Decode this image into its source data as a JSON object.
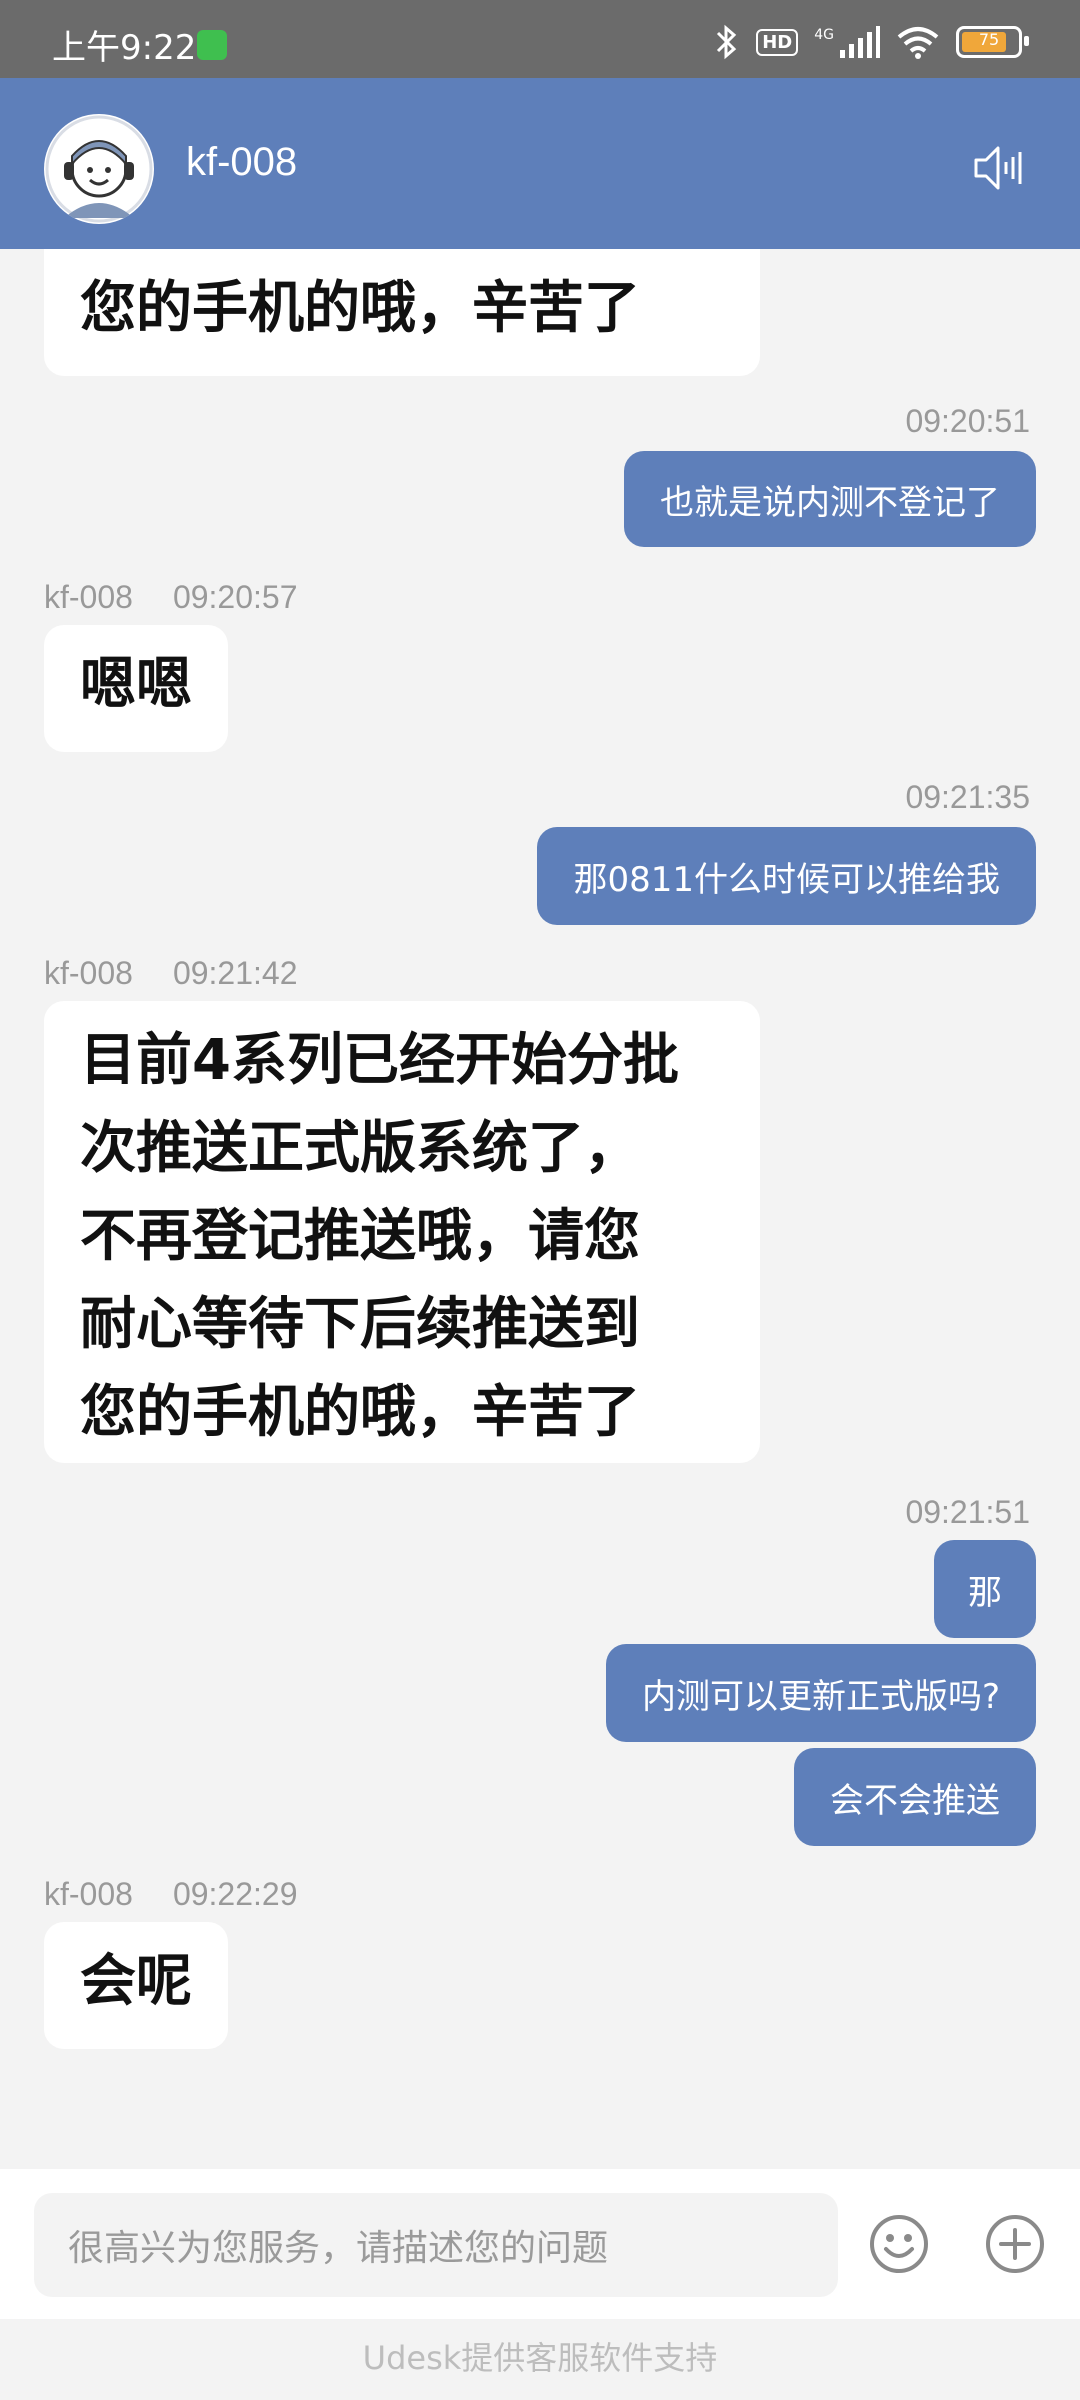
{
  "status_bar": {
    "time": "上午9:22",
    "network": "4G",
    "hd": "HD",
    "battery": "75"
  },
  "header": {
    "title": "kf-008"
  },
  "messages": {
    "m0": {
      "text": "您的手机的哦，辛苦了"
    },
    "m1": {
      "time": "09:20:51",
      "text": "也就是说内测不登记了"
    },
    "m2": {
      "sender": "kf-008",
      "time": "09:20:57",
      "text": "嗯嗯"
    },
    "m3": {
      "time": "09:21:35",
      "text": "那0811什么时候可以推给我"
    },
    "m4": {
      "sender": "kf-008",
      "time": "09:21:42",
      "lines": [
        "目前4系列已经开始分批",
        "次推送正式版系统了，",
        "不再登记推送哦，请您",
        "耐心等待下后续推送到",
        "您的手机的哦，辛苦了"
      ]
    },
    "m5": {
      "time": "09:21:51",
      "text": "那"
    },
    "m6": {
      "text": "内测可以更新正式版吗?"
    },
    "m7": {
      "text": "会不会推送"
    },
    "m8": {
      "sender": "kf-008",
      "time": "09:22:29",
      "text": "会呢"
    }
  },
  "input": {
    "placeholder": "很高兴为您服务，请描述您的问题"
  },
  "footer": {
    "text": "Udesk提供客服软件支持"
  },
  "colors": {
    "header": "#5e7fba",
    "outgoing_bubble": "#5e7fba",
    "background": "#f3f3f3"
  },
  "icons": [
    "bluetooth-icon",
    "signal-icon",
    "wifi-icon",
    "battery-icon",
    "speaker-icon",
    "emoji-icon",
    "plus-icon"
  ]
}
